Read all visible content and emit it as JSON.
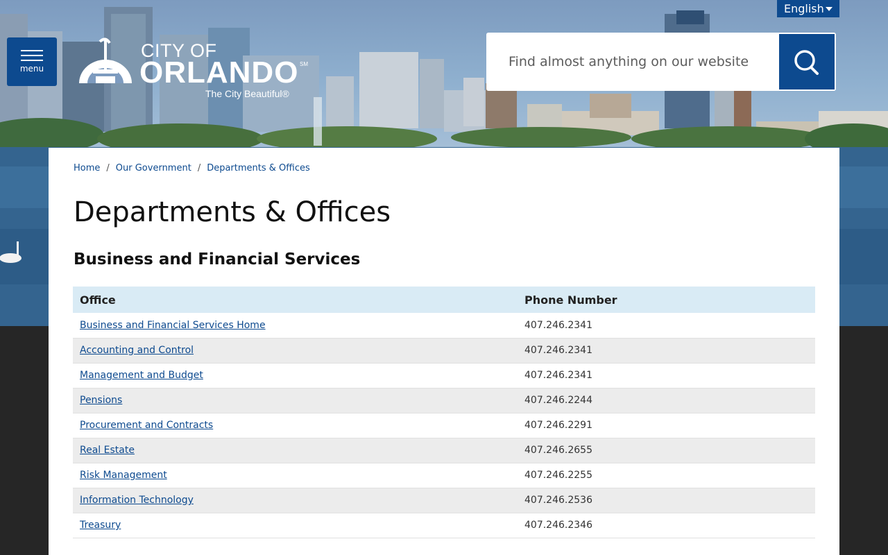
{
  "header": {
    "menu_label": "menu",
    "language": "English",
    "search_placeholder": "Find almost anything on our website",
    "logo": {
      "line1": "CITY OF",
      "line2": "ORLANDO",
      "service_mark": "SM",
      "tagline": "The City Beautiful®"
    }
  },
  "breadcrumb": {
    "items": [
      "Home",
      "Our Government",
      "Departments & Offices"
    ],
    "separator": "/"
  },
  "page": {
    "title": "Departments & Offices",
    "section_title": "Business and Financial Services"
  },
  "table": {
    "headers": [
      "Office",
      "Phone Number"
    ],
    "rows": [
      {
        "office": "Business and Financial Services Home",
        "phone": "407.246.2341"
      },
      {
        "office": "Accounting and Control",
        "phone": "407.246.2341"
      },
      {
        "office": "Management and Budget",
        "phone": "407.246.2341"
      },
      {
        "office": "Pensions",
        "phone": "407.246.2244"
      },
      {
        "office": "Procurement and Contracts",
        "phone": "407.246.2291"
      },
      {
        "office": "Real Estate",
        "phone": "407.246.2655"
      },
      {
        "office": "Risk Management",
        "phone": "407.246.2255"
      },
      {
        "office": "Information Technology",
        "phone": "407.246.2536"
      },
      {
        "office": "Treasury",
        "phone": "407.246.2346"
      }
    ]
  },
  "colors": {
    "brand_blue": "#0d4a8f",
    "table_header_bg": "#d9ebf5",
    "row_stripe": "#ececec"
  },
  "icons": {
    "menu": "hamburger-icon",
    "search": "search-icon",
    "language": "caret-down-icon"
  }
}
